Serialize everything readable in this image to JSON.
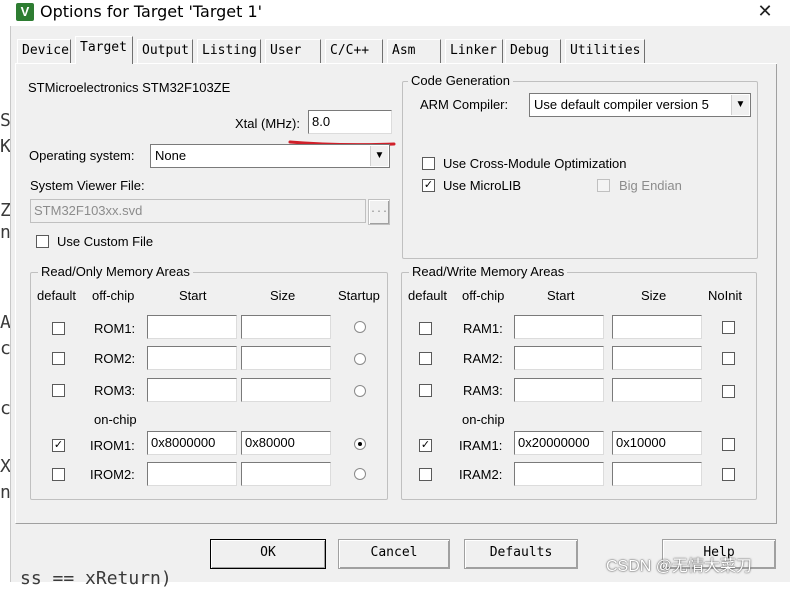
{
  "window": {
    "title": "Options for Target 'Target 1'",
    "app_icon": "uv-logo-icon",
    "close_glyph": "✕"
  },
  "background_fragment": {
    "chars": [
      "S",
      "K",
      "Z",
      "n",
      "A",
      "c",
      "c",
      "X",
      "n"
    ],
    "bottom_text": "ss == xReturn)"
  },
  "tabs": [
    {
      "label": "Device",
      "active": false
    },
    {
      "label": "Target",
      "active": true
    },
    {
      "label": "Output",
      "active": false
    },
    {
      "label": "Listing",
      "active": false
    },
    {
      "label": "User",
      "active": false
    },
    {
      "label": "C/C++",
      "active": false
    },
    {
      "label": "Asm",
      "active": false
    },
    {
      "label": "Linker",
      "active": false
    },
    {
      "label": "Debug",
      "active": false
    },
    {
      "label": "Utilities",
      "active": false
    }
  ],
  "target": {
    "device_name": "STMicroelectronics STM32F103ZE",
    "xtal_label": "Xtal (MHz):",
    "xtal_value": "8.0",
    "os_label": "Operating system:",
    "os_value": "None",
    "svd_label": "System Viewer File:",
    "svd_value": "STM32F103xx.svd",
    "svd_browse": "...",
    "custom_file_label": "Use Custom File",
    "custom_file_checked": false
  },
  "code_generation": {
    "title": "Code Generation",
    "compiler_label": "ARM Compiler:",
    "compiler_value": "Use default compiler version 5",
    "cross_module_label": "Use Cross-Module Optimization",
    "cross_module_checked": false,
    "microlib_label": "Use MicroLIB",
    "microlib_checked": true,
    "big_endian_label": "Big Endian",
    "big_endian_checked": false
  },
  "readonly_memory": {
    "title": "Read/Only Memory Areas",
    "headers": {
      "default": "default",
      "offchip": "off-chip",
      "start": "Start",
      "size": "Size",
      "startup": "Startup"
    },
    "onchip_label": "on-chip",
    "rows": [
      {
        "name": "ROM1:",
        "default": false,
        "start": "",
        "size": "",
        "startup": false
      },
      {
        "name": "ROM2:",
        "default": false,
        "start": "",
        "size": "",
        "startup": false
      },
      {
        "name": "ROM3:",
        "default": false,
        "start": "",
        "size": "",
        "startup": false
      },
      {
        "name": "IROM1:",
        "default": true,
        "start": "0x8000000",
        "size": "0x80000",
        "startup": true
      },
      {
        "name": "IROM2:",
        "default": false,
        "start": "",
        "size": "",
        "startup": false
      }
    ]
  },
  "readwrite_memory": {
    "title": "Read/Write Memory Areas",
    "headers": {
      "default": "default",
      "offchip": "off-chip",
      "start": "Start",
      "size": "Size",
      "noinit": "NoInit"
    },
    "onchip_label": "on-chip",
    "rows": [
      {
        "name": "RAM1:",
        "default": false,
        "start": "",
        "size": "",
        "noinit": false
      },
      {
        "name": "RAM2:",
        "default": false,
        "start": "",
        "size": "",
        "noinit": false
      },
      {
        "name": "RAM3:",
        "default": false,
        "start": "",
        "size": "",
        "noinit": false
      },
      {
        "name": "IRAM1:",
        "default": true,
        "start": "0x20000000",
        "size": "0x10000",
        "noinit": false
      },
      {
        "name": "IRAM2:",
        "default": false,
        "start": "",
        "size": "",
        "noinit": false
      }
    ]
  },
  "buttons": {
    "ok": "OK",
    "cancel": "Cancel",
    "defaults": "Defaults",
    "help": "Help"
  },
  "annotation_color": "#d0202a",
  "watermark": "CSDN @无情大菜刀"
}
